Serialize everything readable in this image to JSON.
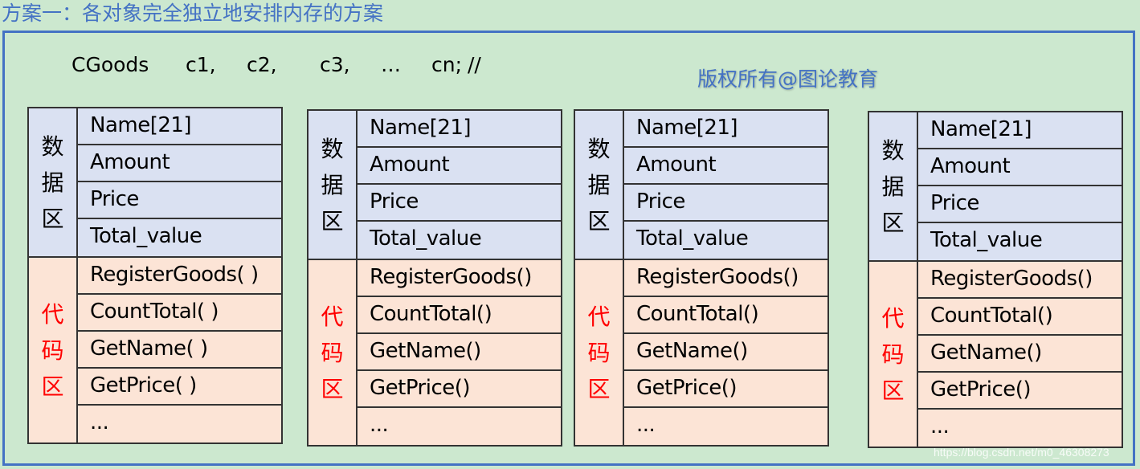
{
  "title": "方案一：各对象完全独立地安排内存的方案",
  "declaration": {
    "class_name": "CGoods",
    "objects": [
      "c1,",
      "c2,",
      "c3,",
      "…",
      "cn;"
    ],
    "comment": "//"
  },
  "copyright": "版权所有@图论教育",
  "objects": [
    {
      "data_label": [
        "数",
        "据",
        "区"
      ],
      "data_fields": [
        "Name[21]",
        "Amount",
        "Price",
        "Total_value"
      ],
      "code_label": [
        "代",
        "码",
        "区"
      ],
      "code_methods": [
        "RegisterGoods( )",
        "CountTotal( )",
        "GetName( )",
        "GetPrice( )",
        "..."
      ]
    },
    {
      "data_label": [
        "数",
        "据",
        "区"
      ],
      "data_fields": [
        "Name[21]",
        "Amount",
        "Price",
        "Total_value"
      ],
      "code_label": [
        "代",
        "码",
        "区"
      ],
      "code_methods": [
        "RegisterGoods()",
        "CountTotal()",
        "GetName()",
        "GetPrice()",
        "..."
      ]
    },
    {
      "data_label": [
        "数",
        "据",
        "区"
      ],
      "data_fields": [
        "Name[21]",
        "Amount",
        "Price",
        "Total_value"
      ],
      "code_label": [
        "代",
        "码",
        "区"
      ],
      "code_methods": [
        "RegisterGoods()",
        "CountTotal()",
        "GetName()",
        "GetPrice()",
        "..."
      ]
    },
    {
      "data_label": [
        "数",
        "据",
        "区"
      ],
      "data_fields": [
        "Name[21]",
        "Amount",
        "Price",
        "Total_value"
      ],
      "code_label": [
        "代",
        "码",
        "区"
      ],
      "code_methods": [
        "RegisterGoods()",
        "CountTotal()",
        "GetName()",
        "GetPrice()",
        "..."
      ]
    }
  ],
  "watermark": "https://blog.csdn.net/m0_46308273",
  "colors": {
    "background": "#cce8cf",
    "accent_blue": "#4472c4",
    "data_area": "#dae1f2",
    "code_area": "#fce4d6",
    "code_label": "#ff0000"
  }
}
